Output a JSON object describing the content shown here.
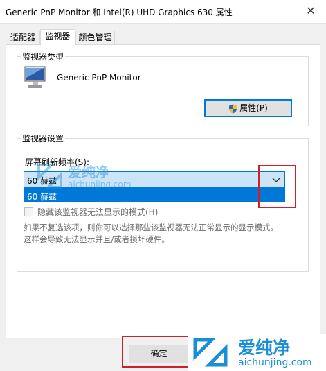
{
  "window": {
    "title": "Generic PnP Monitor 和 Intel(R) UHD Graphics 630 属性",
    "close_glyph": "✕"
  },
  "tabs": [
    {
      "label": "适配器",
      "active": false
    },
    {
      "label": "监视器",
      "active": true
    },
    {
      "label": "颜色管理",
      "active": false
    }
  ],
  "monitor_type": {
    "group_label": "监视器类型",
    "monitor_name": "Generic PnP Monitor",
    "properties_button": "属性(P)",
    "properties_icon": "shield-icon"
  },
  "monitor_settings": {
    "group_label": "监视器设置",
    "refresh_label": "屏幕刷新频率(S):",
    "selected_rate": "60 赫兹",
    "dropdown_options": [
      "60 赫兹"
    ],
    "hide_modes_label": "隐藏该监视器无法显示的模式(H)",
    "hide_modes_checked": false,
    "warning_line1": "如果不复选该项，则你可以选择那些该监视器无法正常显示的显示模式。",
    "warning_line2": "这样会导致无法显示并且/或者损坏硬件。"
  },
  "footer": {
    "ok_button": "确定"
  },
  "watermark": {
    "brand": "爱纯净",
    "url": "aichunjing.com"
  },
  "colors": {
    "accent": "#0078d7",
    "highlight_red": "#d11f27",
    "watermark_blue": "#1a8fd6"
  }
}
